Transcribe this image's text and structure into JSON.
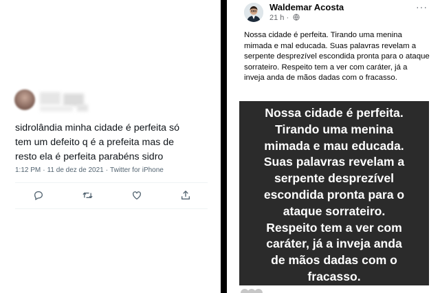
{
  "tweet": {
    "text": "sidrolândia minha cidade é perfeita só\ntem um defeito q é a prefeita mas de\nresto ela é perfeita parabéns sidro",
    "time": "1:12 PM",
    "date": "11 de dez de 2021",
    "source": "Twitter for iPhone",
    "actions": [
      {
        "name": "reply",
        "icon": "reply-icon"
      },
      {
        "name": "retweet",
        "icon": "retweet-icon"
      },
      {
        "name": "like",
        "icon": "heart-icon"
      },
      {
        "name": "share",
        "icon": "share-icon"
      }
    ]
  },
  "post": {
    "author": "Waldemar Acosta",
    "time": "21 h",
    "more": "···",
    "text": "Nossa cidade é perfeita. Tirando uma menina mimada e mal educada. Suas palavras revelam a serpente desprezível escondida pronta para o ataque sorrateiro. Respeito tem a ver com caráter, já a inveja anda de mãos dadas com o fracasso.",
    "image_text": "Nossa cidade é perfeita.\nTirando uma menina\nmimada e mau educada.\nSuas palavras revelam a\nserpente desprezível\nescondida pronta para o\nataque sorrateiro.\nRespeito tem a ver com\ncaráter, já a inveja anda\nde mãos dadas com o\nfracasso."
  },
  "colors": {
    "tweet_icon": "#536471",
    "image_bg": "#2b2b2b",
    "divider": "#000000"
  }
}
